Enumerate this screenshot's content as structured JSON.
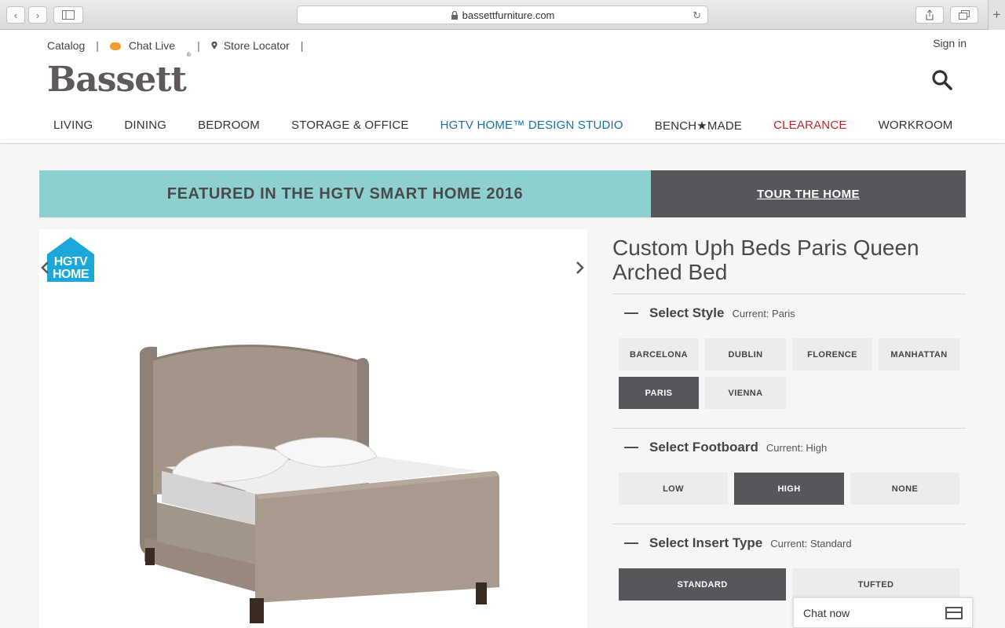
{
  "browser": {
    "url": "bassettfurniture.com"
  },
  "header": {
    "top_links": {
      "catalog": "Catalog",
      "chat_live": "Chat Live",
      "store_locator": "Store Locator"
    },
    "sign_in": "Sign in",
    "logo_text": "Bassett",
    "logo_mark": "®",
    "nav": {
      "living": "LIVING",
      "dining": "DINING",
      "bedroom": "BEDROOM",
      "storage": "STORAGE & OFFICE",
      "hgtv": "HGTV HOME™ DESIGN STUDIO",
      "benchmade": "BENCH★MADE",
      "clearance": "CLEARANCE",
      "workroom": "WORKROOM"
    }
  },
  "banner": {
    "featured": "FEATURED IN THE HGTV SMART HOME 2016",
    "tour": "TOUR THE HOME",
    "featured_color": "#8ecfcf",
    "tour_color": "#58565a"
  },
  "product": {
    "hgtv_badge": {
      "line1": "HGTV",
      "line2": "HOME",
      "color": "#19a8d9"
    },
    "title": "Custom Uph Beds Paris Queen Arched Bed",
    "style": {
      "label": "Select Style",
      "current": "Current: Paris",
      "options": [
        "BARCELONA",
        "DUBLIN",
        "FLORENCE",
        "MANHATTAN",
        "PARIS",
        "VIENNA"
      ],
      "selected": "PARIS"
    },
    "footboard": {
      "label": "Select Footboard",
      "current": "Current: High",
      "options": [
        "LOW",
        "HIGH",
        "NONE"
      ],
      "selected": "HIGH"
    },
    "insert": {
      "label": "Select Insert Type",
      "current": "Current: Standard",
      "options": [
        "STANDARD",
        "TUFTED"
      ],
      "selected": "STANDARD"
    }
  },
  "chat_widget": {
    "label": "Chat now"
  }
}
